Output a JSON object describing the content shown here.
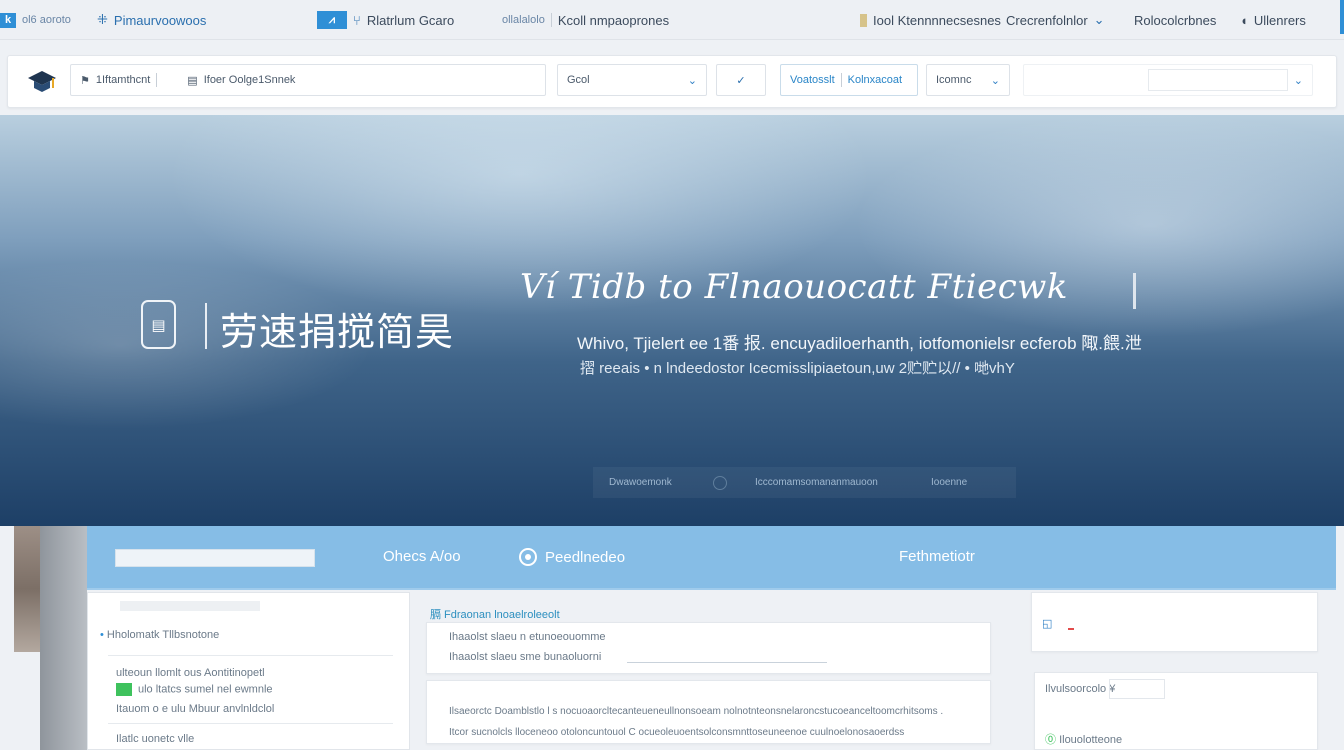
{
  "topnav": {
    "brand_text": "ol6 aoroto",
    "app_name": "Pimaurvoowoos",
    "section": "Rlatrlum Gcaro",
    "sub_link": "ollalalolo",
    "extra_link": "Kcoll nmpaoprones",
    "right1": "Iool Ktennnnecsesnes",
    "right2": "Crecrenfolnlor",
    "right3": "Rolocolcrbnes",
    "right4": "Ullenrers"
  },
  "toolbar": {
    "search_tag": "1Iftamthcnt",
    "search_value": "Ifoer  Oolge1Snnek",
    "select1": "Gcol",
    "link1": "Voatosslt",
    "link2": "Kolnxacoat",
    "select2": "Icomnc",
    "search_placeholder": ""
  },
  "hero": {
    "badge_glyph": "▤",
    "brand": "劳速捐搅简昊",
    "title": "Ví Tidb to Flnaouocatt Ftiecwk",
    "subtitle1": "Whivo, Tjielert ee 1番 报. encuyadiloerhanth, iotfomonielsr ecferob 陬.餵.泄",
    "subtitle2": "摺 reeais • n lndeedostor Icecmisslipiaetoun,uw 2贮贮以// • 哋vhY",
    "strip": [
      "Dwawoemonk",
      "Icccomamsomananmauoon",
      "Iooenne"
    ]
  },
  "tabs": {
    "link1": "Ohecs A/oo",
    "link2": "Peedlnedeo",
    "link3": "Fethmetiotr"
  },
  "panels": {
    "left_heading": "Hholomatk Tllbsnotone",
    "left_item1": "ulteoun llomlt ous Aontitinopetl",
    "left_item2": "ulo ltatcs sumel nel ewmnle",
    "left_item3": "Itauom o e ulu Mbuur anvlnldclol",
    "left_item4": "Ilatlc uonetc vlle",
    "mid_heading": "膈 Fdraonan lnoaelroleeolt",
    "mid_line1": "Ihaaolst slaeu  n   etunoeouomme",
    "mid_line2": "Ihaaolst slaeu sme bunaoluorni",
    "mid_card2_line1": "Ilsaeorctc Doamblstlo l s nocuoaorcltecanteueneullnonsoeam nolnotnteonsnelaroncstucoeanceltoomcrhitsoms .",
    "mid_card2_line2": "Itcor sucnolcls lloceneoo otoloncuntouol C ocueoleuoentsolconsmnttoseuneenoe cuulnoelonosaoerdss",
    "right_top_icon": "◱",
    "right_field_label": "Ilvulsoorcolo ¥",
    "right_bottom_label": "Ilouolotteone"
  }
}
